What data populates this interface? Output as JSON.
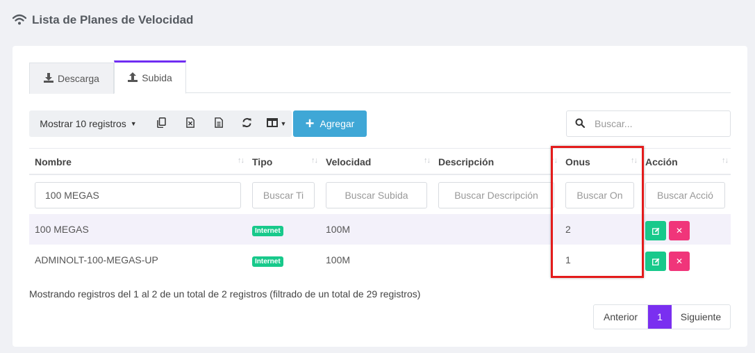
{
  "page": {
    "title": "Lista de Planes de Velocidad",
    "icon": "wifi-icon"
  },
  "tabs": [
    {
      "label": "Descarga",
      "icon": "download-icon",
      "active": false
    },
    {
      "label": "Subida",
      "icon": "upload-icon",
      "active": true
    }
  ],
  "toolbar": {
    "show_records_label": "Mostrar 10 registros",
    "buttons": [
      "copy-icon",
      "excel-icon",
      "csv-icon",
      "refresh-icon",
      "columns-icon"
    ],
    "add_label": "Agregar"
  },
  "search": {
    "placeholder": "Buscar..."
  },
  "table": {
    "columns": [
      "Nombre",
      "Tipo",
      "Velocidad",
      "Descripción",
      "Onus",
      "Acción"
    ],
    "filters": {
      "nombre_value": "100 MEGAS",
      "tipo_placeholder": "Buscar Ti",
      "velocidad_placeholder": "Buscar Subida",
      "descripcion_placeholder": "Buscar Descripción",
      "onus_placeholder": "Buscar On",
      "accion_placeholder": "Buscar Acció"
    },
    "rows": [
      {
        "nombre": "100 MEGAS",
        "tipo": "Internet",
        "velocidad": "100M",
        "descripcion": "",
        "onus": "2"
      },
      {
        "nombre": "ADMINOLT-100-MEGAS-UP",
        "tipo": "Internet",
        "velocidad": "100M",
        "descripcion": "",
        "onus": "1"
      }
    ]
  },
  "info": "Mostrando registros del 1 al 2 de un total de 2 registros (filtrado de un total de 29 registros)",
  "pagination": {
    "prev": "Anterior",
    "current": "1",
    "next": "Siguiente"
  },
  "colors": {
    "accent": "#7a2ff0",
    "primary_button": "#3fa7d6",
    "success": "#18c98b",
    "danger": "#f0357a",
    "highlight": "#e41b1b"
  }
}
